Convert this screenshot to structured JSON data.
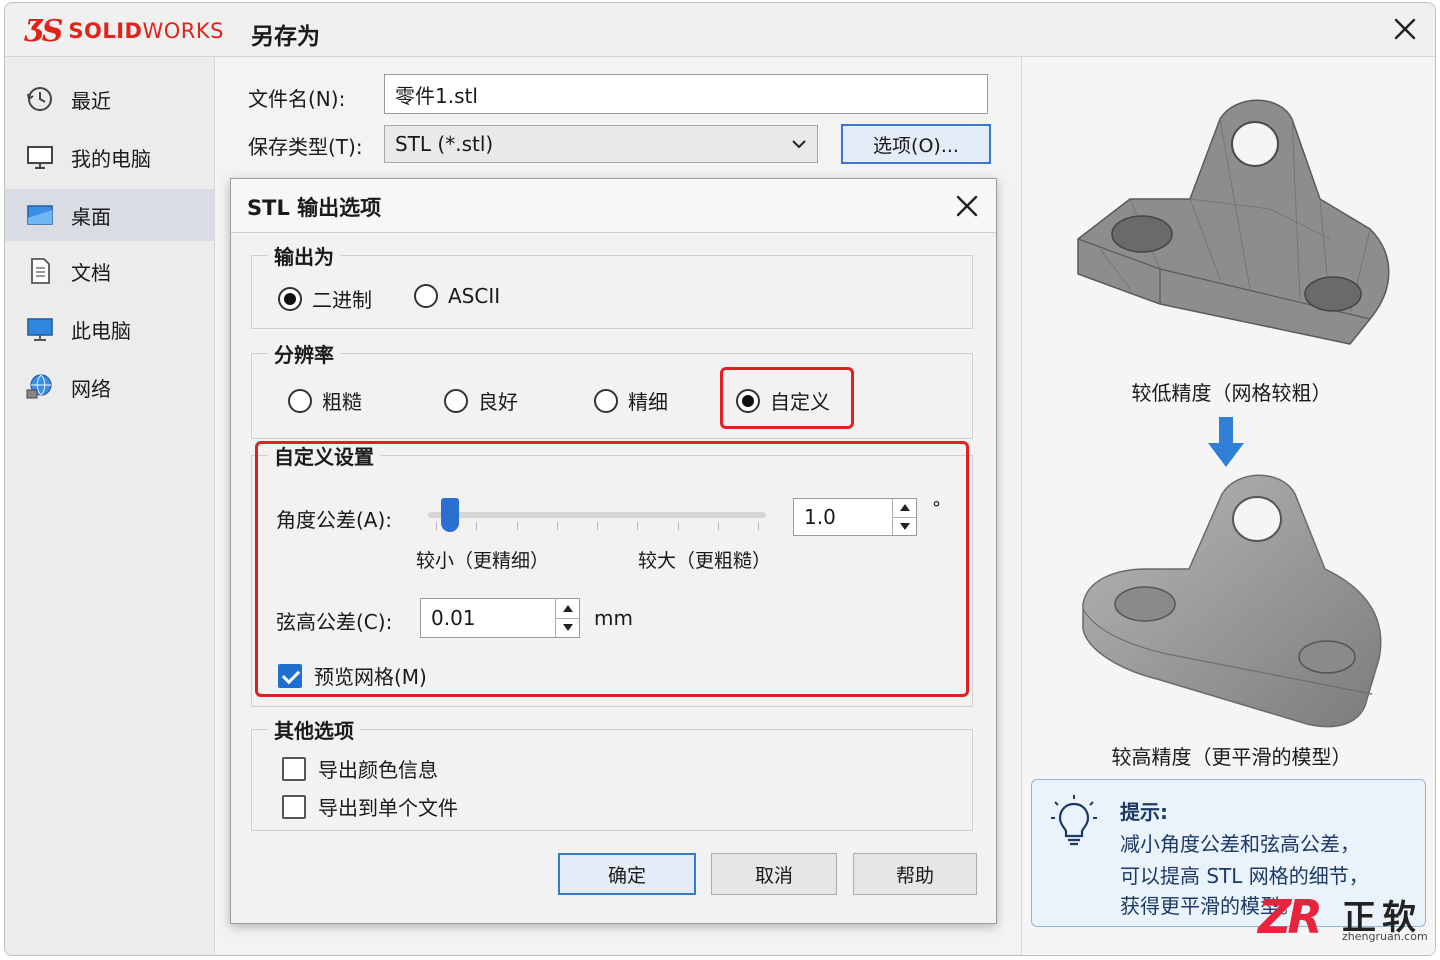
{
  "window": {
    "title": "另存为",
    "logo_solid": "SOLID",
    "logo_works": "WORKS",
    "logo_mark": "ƷS"
  },
  "sidebar": {
    "items": [
      {
        "label": "最近",
        "icon": "clock-icon"
      },
      {
        "label": "我的电脑",
        "icon": "monitor-icon"
      },
      {
        "label": "桌面",
        "icon": "desktop-icon",
        "active": true
      },
      {
        "label": "文档",
        "icon": "document-icon"
      },
      {
        "label": "此电脑",
        "icon": "computer-icon"
      },
      {
        "label": "网络",
        "icon": "network-icon"
      }
    ]
  },
  "save": {
    "filename_label": "文件名(N):",
    "filename_value": "零件1.stl",
    "type_label": "保存类型(T):",
    "type_value": "STL (*.stl)",
    "options_button": "选项(O)..."
  },
  "dialog": {
    "title": "STL 输出选项",
    "output": {
      "title": "输出为",
      "binary": "二进制",
      "ascii": "ASCII",
      "selected": "二进制"
    },
    "resolution": {
      "title": "分辨率",
      "coarse": "粗糙",
      "fine": "良好",
      "finer": "精细",
      "custom": "自定义",
      "selected": "自定义"
    },
    "custom": {
      "title": "自定义设置",
      "angle_label": "角度公差(A):",
      "angle_value": "1.0",
      "angle_unit": "°",
      "slider_min_label": "较小（更精细）",
      "slider_max_label": "较大（更粗糙）",
      "slider_fraction": 0.04,
      "chord_label": "弦高公差(C):",
      "chord_value": "0.01",
      "chord_unit": "mm",
      "preview_label": "预览网格(M)",
      "preview_checked": true
    },
    "other": {
      "title": "其他选项",
      "color_label": "导出颜色信息",
      "color_checked": false,
      "single_label": "导出到单个文件",
      "single_checked": false
    },
    "buttons": {
      "ok": "确定",
      "cancel": "取消",
      "help": "帮助"
    }
  },
  "preview": {
    "low_caption": "较低精度（网格较粗）",
    "high_caption": "较高精度（更平滑的模型）",
    "tip_title": "提示:",
    "tip_lines": [
      "减小角度公差和弦高公差，",
      "可以提高 STL 网格的细节，",
      "获得更平滑的模型。"
    ]
  },
  "watermark": {
    "mark": "ZR",
    "name": "正软",
    "url": "zhengruan.com"
  },
  "colors": {
    "accent": "#2b6fd0",
    "highlight": "#e02020",
    "tip_bg": "#eaf2fb"
  }
}
